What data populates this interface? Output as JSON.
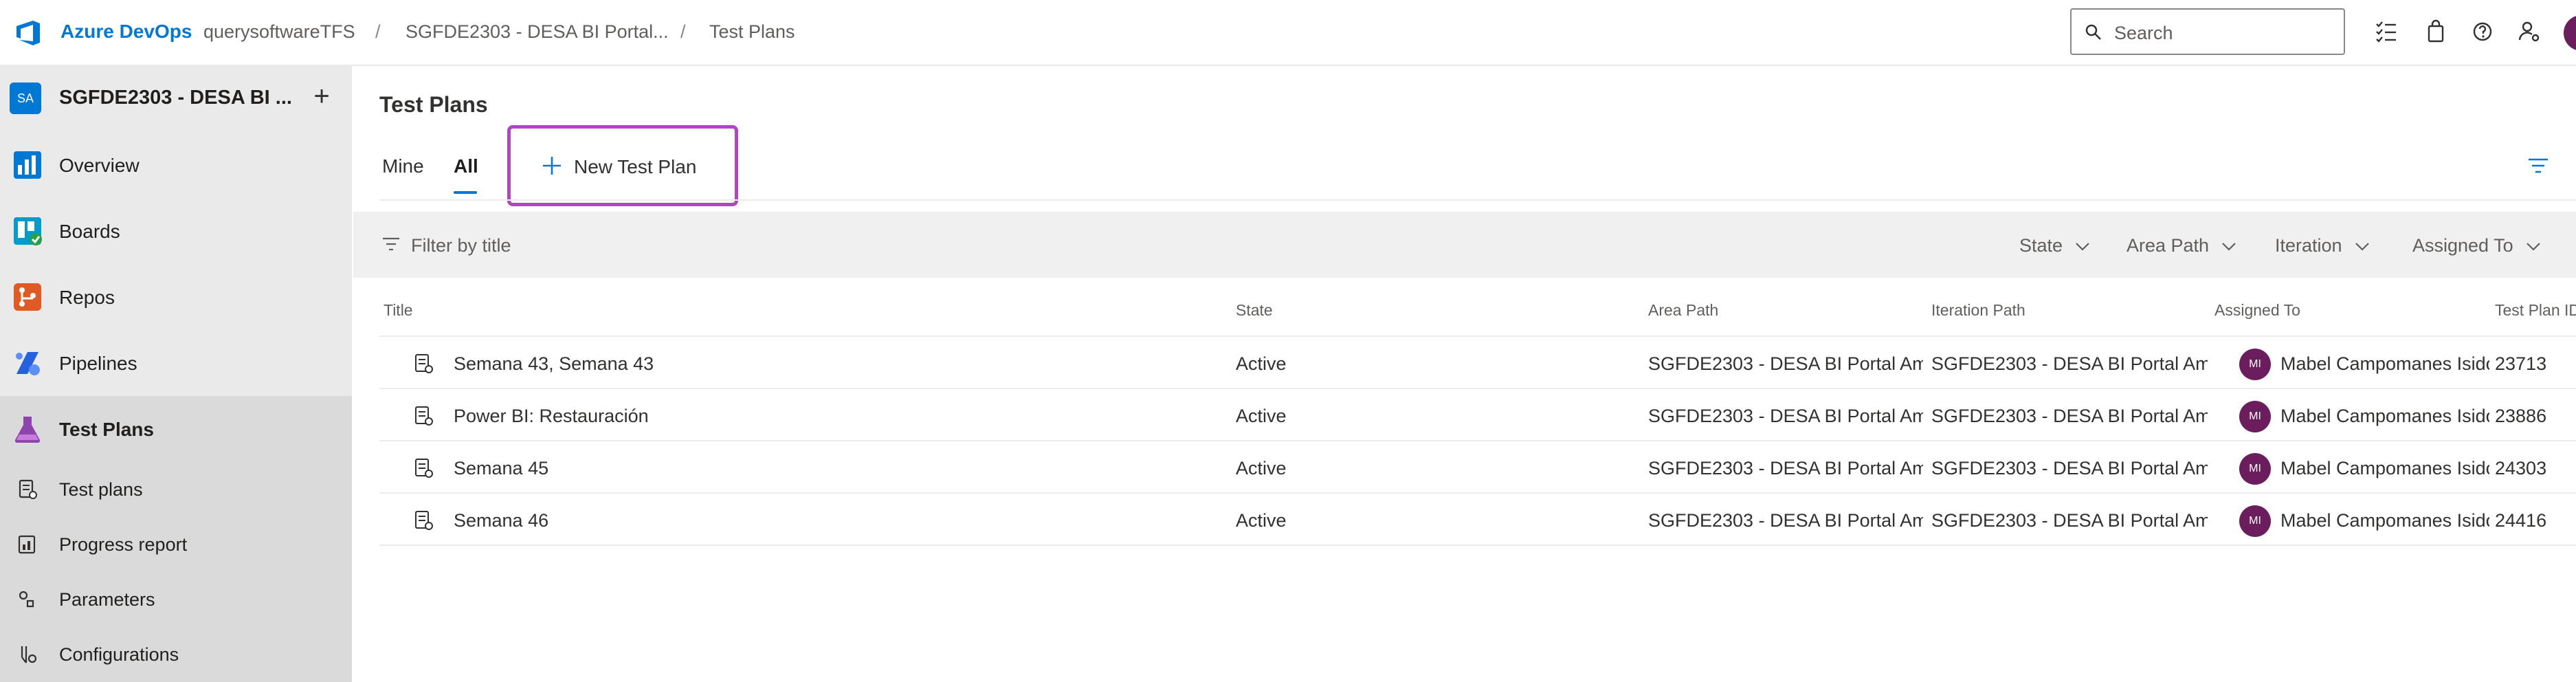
{
  "topbar": {
    "brand": "Azure DevOps",
    "org": "querysoftwareTFS",
    "sep1": "/",
    "project": "SGFDE2303 - DESA BI Portal...",
    "sep2": "/",
    "page": "Test Plans",
    "search_placeholder": "Search",
    "icons": [
      "task-list-icon",
      "shopping-bag-icon",
      "help-icon",
      "user-settings-icon"
    ]
  },
  "sidebar": {
    "project_badge": "SA",
    "project_name": "SGFDE2303 - DESA BI ...",
    "add_label": "+",
    "items": [
      {
        "label": "Overview",
        "icon": "overview-icon",
        "color": "#0078d4"
      },
      {
        "label": "Boards",
        "icon": "boards-icon",
        "color": "#009ccc"
      },
      {
        "label": "Repos",
        "icon": "repos-icon",
        "color": "#e05a26"
      },
      {
        "label": "Pipelines",
        "icon": "pipelines-icon",
        "color": "#2560e0"
      },
      {
        "label": "Test Plans",
        "icon": "test-plans-icon",
        "color": "#8d44ad",
        "active": true
      }
    ],
    "subitems": [
      {
        "label": "Test plans",
        "icon": "test-plans-list-icon"
      },
      {
        "label": "Progress report",
        "icon": "progress-report-icon"
      },
      {
        "label": "Parameters",
        "icon": "parameters-icon"
      },
      {
        "label": "Configurations",
        "icon": "configurations-icon"
      }
    ]
  },
  "main": {
    "title": "Test Plans",
    "tabs": [
      {
        "label": "Mine",
        "selected": false
      },
      {
        "label": "All",
        "selected": true
      }
    ],
    "new_plan_label": "New Test Plan",
    "filter_placeholder": "Filter by title",
    "dropdowns": [
      "State",
      "Area Path",
      "Iteration",
      "Assigned To"
    ],
    "columns": [
      "Title",
      "State",
      "Area Path",
      "Iteration Path",
      "Assigned To",
      "Test Plan ID"
    ],
    "rows": [
      {
        "title": "Semana 43, Semana 43",
        "state": "Active",
        "area": "SGFDE2303 - DESA BI Portal Am",
        "iteration": "SGFDE2303 - DESA BI Portal Am",
        "initials": "MI",
        "assigned": "Mabel Campomanes Isidoro",
        "id": "23713"
      },
      {
        "title": "Power BI: Restauración",
        "state": "Active",
        "area": "SGFDE2303 - DESA BI Portal Am",
        "iteration": "SGFDE2303 - DESA BI Portal Am",
        "initials": "MI",
        "assigned": "Mabel Campomanes Isidoro",
        "id": "23886"
      },
      {
        "title": "Semana 45",
        "state": "Active",
        "area": "SGFDE2303 - DESA BI Portal Am",
        "iteration": "SGFDE2303 - DESA BI Portal Am",
        "initials": "MI",
        "assigned": "Mabel Campomanes Isidoro",
        "id": "24303"
      },
      {
        "title": "Semana 46",
        "state": "Active",
        "area": "SGFDE2303 - DESA BI Portal Am",
        "iteration": "SGFDE2303 - DESA BI Portal Am",
        "initials": "MI",
        "assigned": "Mabel Campomanes Isidoro",
        "id": "24416"
      }
    ]
  },
  "colors": {
    "accent": "#0078d4",
    "highlight": "#b146c2",
    "avatar": "#6b1d5e"
  }
}
